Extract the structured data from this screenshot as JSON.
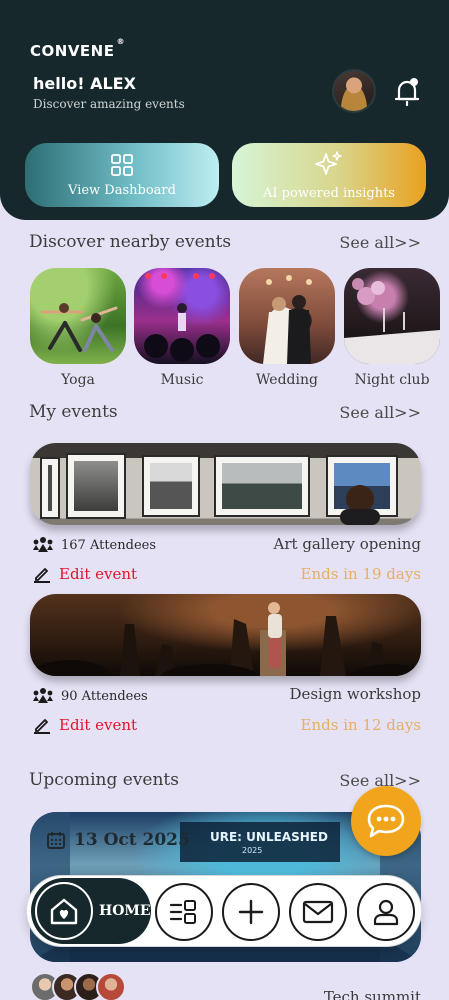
{
  "app": {
    "logo": "CONVENE",
    "trademark": "®"
  },
  "header": {
    "greeting": "hello! ALEX",
    "tagline": "Discover amazing events",
    "actions": [
      {
        "label": "View Dashboard",
        "icon": "dashboard-grid-icon"
      },
      {
        "label": "AI powered insights",
        "icon": "sparkles-icon"
      }
    ]
  },
  "nearby": {
    "title": "Discover nearby events",
    "see_all": "See all>>",
    "categories": [
      {
        "label": "Yoga"
      },
      {
        "label": "Music"
      },
      {
        "label": "Wedding"
      },
      {
        "label": "Night club"
      }
    ]
  },
  "my_events": {
    "title": "My events",
    "see_all": "See all>>",
    "edit_label": "Edit event",
    "items": [
      {
        "attendees": "167 Attendees",
        "name": "Art gallery opening",
        "ends": "Ends in 19 days"
      },
      {
        "attendees": "90 Attendees",
        "name": "Design workshop",
        "ends": "Ends in 12 days"
      }
    ]
  },
  "upcoming": {
    "title": "Upcoming events",
    "see_all": "See all>>",
    "date": "13 Oct 2025",
    "banner_title": "URE: UNLEASHED",
    "banner_sub": "2025",
    "name": "Tech summit"
  },
  "nav": {
    "home_label": "HOME"
  },
  "colors": {
    "dark": "#16282b",
    "background": "#e6e2f6",
    "accent": "#f1a51d",
    "edit": "#e2142b",
    "ends": "#e8ad66"
  }
}
